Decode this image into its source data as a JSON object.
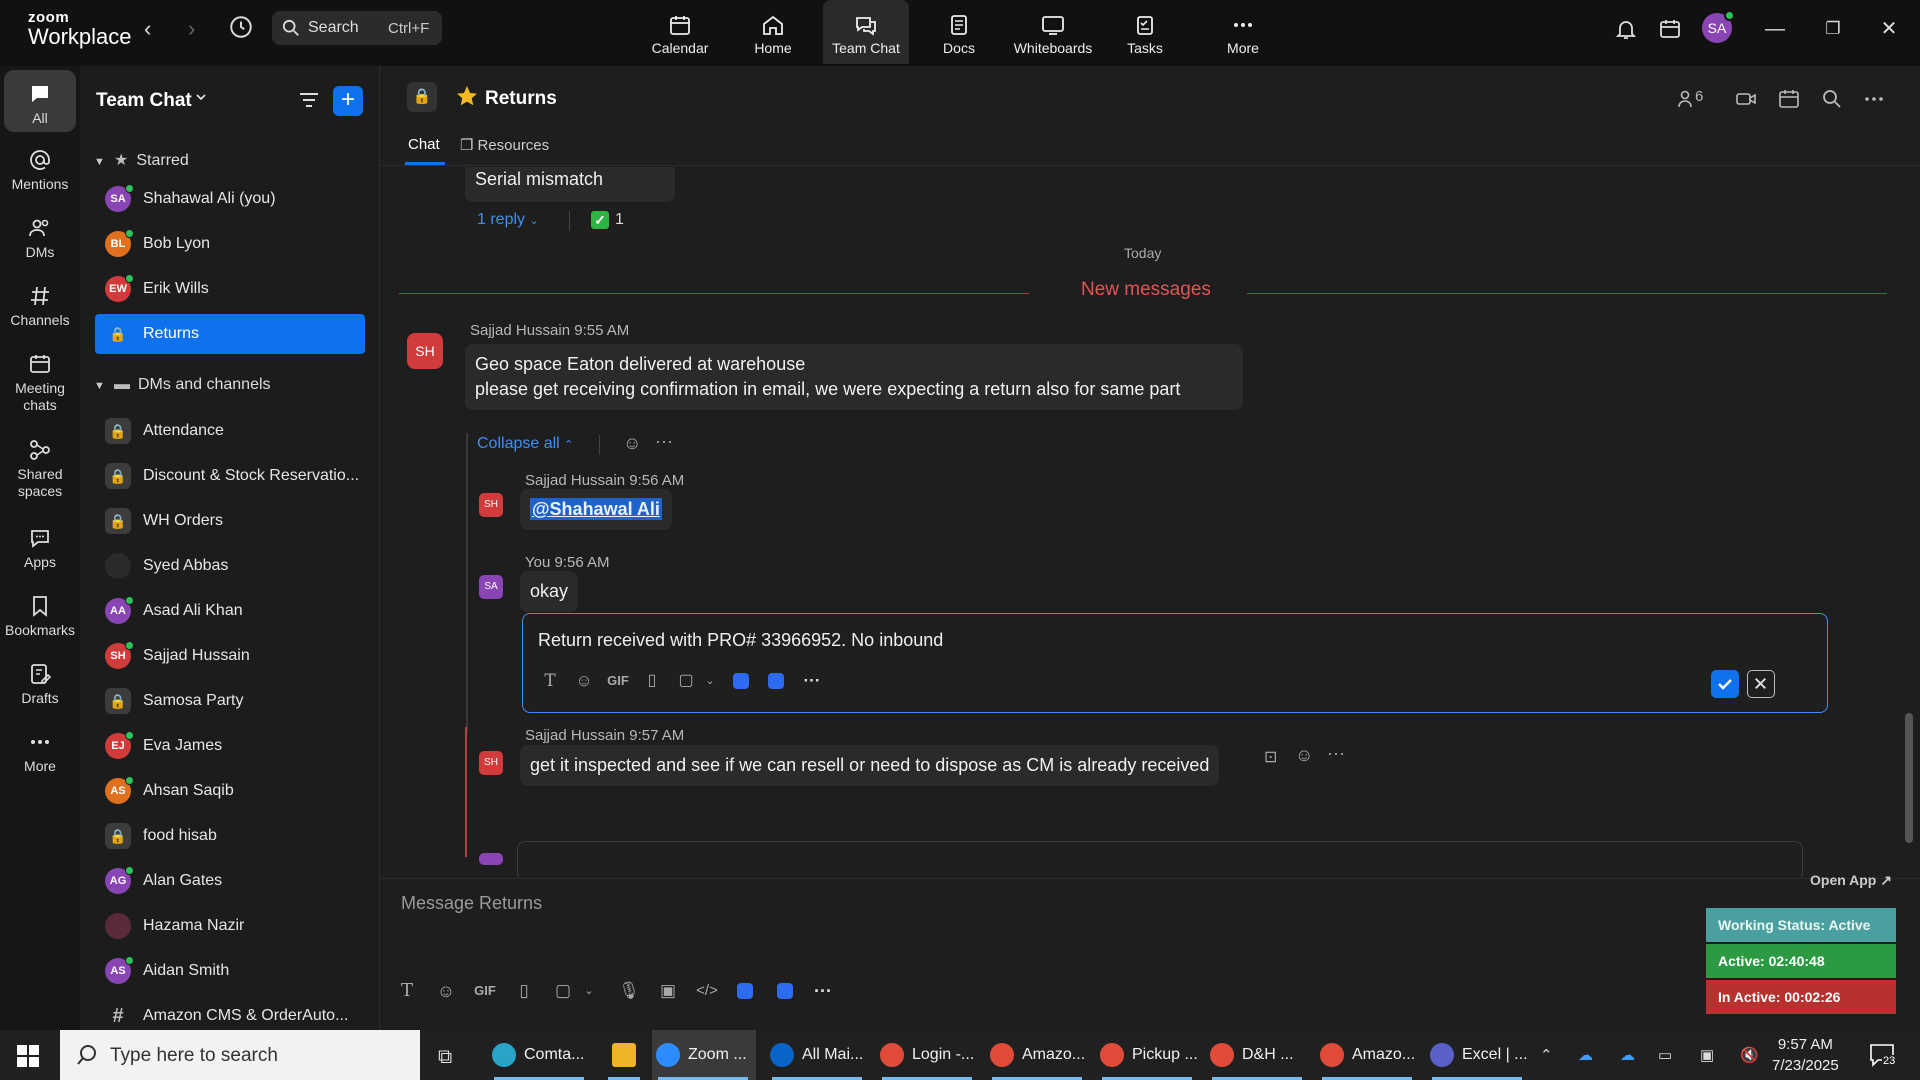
{
  "app": {
    "brand_top": "zoom",
    "brand_bottom": "Workplace"
  },
  "search": {
    "label": "Search",
    "shortcut": "Ctrl+F"
  },
  "topnav": [
    {
      "label": "Calendar"
    },
    {
      "label": "Home"
    },
    {
      "label": "Team Chat"
    },
    {
      "label": "Docs"
    },
    {
      "label": "Whiteboards"
    },
    {
      "label": "Tasks"
    },
    {
      "label": "More"
    }
  ],
  "user": {
    "initials": "SA"
  },
  "rail": [
    {
      "label": "All"
    },
    {
      "label": "Mentions"
    },
    {
      "label": "DMs"
    },
    {
      "label": "Channels"
    },
    {
      "label": "Meeting chats"
    },
    {
      "label": "Shared spaces"
    },
    {
      "label": "Apps"
    },
    {
      "label": "Bookmarks"
    },
    {
      "label": "Drafts"
    },
    {
      "label": "More"
    }
  ],
  "sidebar": {
    "title": "Team Chat",
    "starred_label": "Starred",
    "starred": [
      {
        "initials": "SA",
        "name": "Shahawal Ali (you)",
        "color": "#8a45b5"
      },
      {
        "initials": "BL",
        "name": "Bob Lyon",
        "color": "#e0701e"
      },
      {
        "initials": "EW",
        "name": "Erik Wills",
        "color": "#d13b3b"
      },
      {
        "initials": "",
        "name": "Returns",
        "color": "#0e72ed"
      }
    ],
    "dms_label": "DMs and channels",
    "dms": [
      {
        "initials": "",
        "name": "Attendance",
        "kind": "lock"
      },
      {
        "initials": "",
        "name": "Discount & Stock Reservatio...",
        "kind": "lock"
      },
      {
        "initials": "",
        "name": "WH Orders",
        "kind": "lock"
      },
      {
        "initials": "",
        "name": "Syed Abbas",
        "kind": "photo"
      },
      {
        "initials": "AA",
        "name": "Asad Ali Khan",
        "color": "#8a45b5"
      },
      {
        "initials": "SH",
        "name": "Sajjad Hussain",
        "color": "#d13b3b"
      },
      {
        "initials": "",
        "name": "Samosa Party",
        "kind": "lock"
      },
      {
        "initials": "EJ",
        "name": "Eva James",
        "color": "#d13b3b"
      },
      {
        "initials": "AS",
        "name": "Ahsan Saqib",
        "color": "#e0701e"
      },
      {
        "initials": "",
        "name": "food hisab",
        "kind": "lock"
      },
      {
        "initials": "AG",
        "name": "Alan Gates",
        "color": "#8a45b5"
      },
      {
        "initials": "",
        "name": "Hazama Nazir",
        "kind": "photo2"
      },
      {
        "initials": "AS",
        "name": "Aidan Smith",
        "color": "#8a45b5"
      },
      {
        "initials": "#",
        "name": "Amazon CMS & OrderAuto...",
        "kind": "hash"
      }
    ]
  },
  "channel": {
    "name": "Returns",
    "tabs": [
      "Chat",
      "Resources"
    ],
    "member_count": "6"
  },
  "messages": {
    "prev_text": "Serial mismatch",
    "prev_reply": "1 reply",
    "prev_reaction_count": "1",
    "today": "Today",
    "new_messages": "New messages",
    "m1": {
      "initials": "SH",
      "sender": "Sajjad Hussain 9:55 AM",
      "line1": "Geo space Eaton delivered at warehouse",
      "line2": "please get receiving confirmation in email, we were expecting a return also for same part"
    },
    "collapse": "Collapse all",
    "r1": {
      "initials": "SH",
      "sender": "Sajjad Hussain 9:56 AM",
      "mention": "@Shahawal Ali"
    },
    "r2": {
      "initials": "SA",
      "sender": "You 9:56 AM",
      "text": "okay"
    },
    "edit": {
      "text": "Return received with PRO# 33966952. No inbound",
      "gif": "GIF"
    },
    "r3": {
      "initials": "SH",
      "sender": "Sajjad Hussain 9:57 AM",
      "text": "get it inspected and see if we can resell or need to dispose as CM is already received"
    }
  },
  "composer": {
    "placeholder": "Message Returns",
    "gif": "GIF"
  },
  "widget": {
    "open_app": "Open App ↗",
    "working": "Working Status: Active",
    "active": "Active: 02:40:48",
    "inactive": "In Active: 00:02:26"
  },
  "taskbar": {
    "search": "Type here to search",
    "apps": [
      {
        "label": "Comta...",
        "color": "#2aa3c9"
      },
      {
        "label": "",
        "color": "#f0b429"
      },
      {
        "label": "Zoom ...",
        "color": "#2d8cff"
      },
      {
        "label": "All Mai...",
        "color": "#0a64c8"
      },
      {
        "label": "Login -...",
        "color": "#e04b3a"
      },
      {
        "label": "Amazo...",
        "color": "#e04b3a"
      },
      {
        "label": "Pickup ...",
        "color": "#e04b3a"
      },
      {
        "label": "D&H ...",
        "color": "#e04b3a"
      },
      {
        "label": "Amazo...",
        "color": "#e04b3a"
      },
      {
        "label": "Excel | ...",
        "color": "#5b5fc7"
      }
    ],
    "time": "9:57 AM",
    "date": "7/23/2025",
    "notifications": "23"
  }
}
